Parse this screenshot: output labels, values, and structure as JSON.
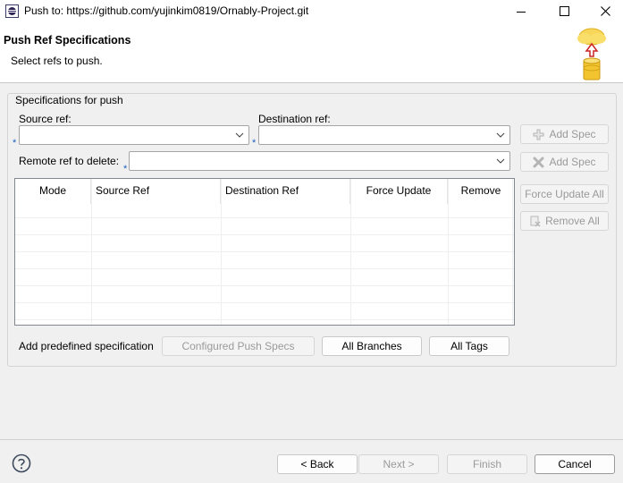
{
  "window": {
    "title": "Push to: https://github.com/yujinkim0819/Ornably-Project.git"
  },
  "header": {
    "title": "Push Ref Specifications",
    "description": "Select refs to push."
  },
  "group": {
    "label": "Specifications for push",
    "source_ref_label": "Source ref:",
    "destination_ref_label": "Destination ref:",
    "remote_delete_label": "Remote ref to delete:",
    "required_marker": "*",
    "source_ref_value": "",
    "destination_ref_value": "",
    "remote_delete_value": ""
  },
  "side_buttons": {
    "add_spec": "Add Spec",
    "add_delete_spec": "Add Spec",
    "force_update_all": "Force Update All",
    "remove_all": "Remove All"
  },
  "table": {
    "columns": [
      "Mode",
      "Source Ref",
      "Destination Ref",
      "Force Update",
      "Remove"
    ],
    "rows": []
  },
  "predefined": {
    "label": "Add predefined specification",
    "configured": "Configured Push Specs",
    "all_branches": "All Branches",
    "all_tags": "All Tags"
  },
  "footer": {
    "back": "< Back",
    "next": "Next >",
    "finish": "Finish",
    "cancel": "Cancel"
  },
  "icons": {
    "app": "eclipse-app-icon",
    "banner": "cloud-push-database-icon",
    "help": "help-icon"
  }
}
